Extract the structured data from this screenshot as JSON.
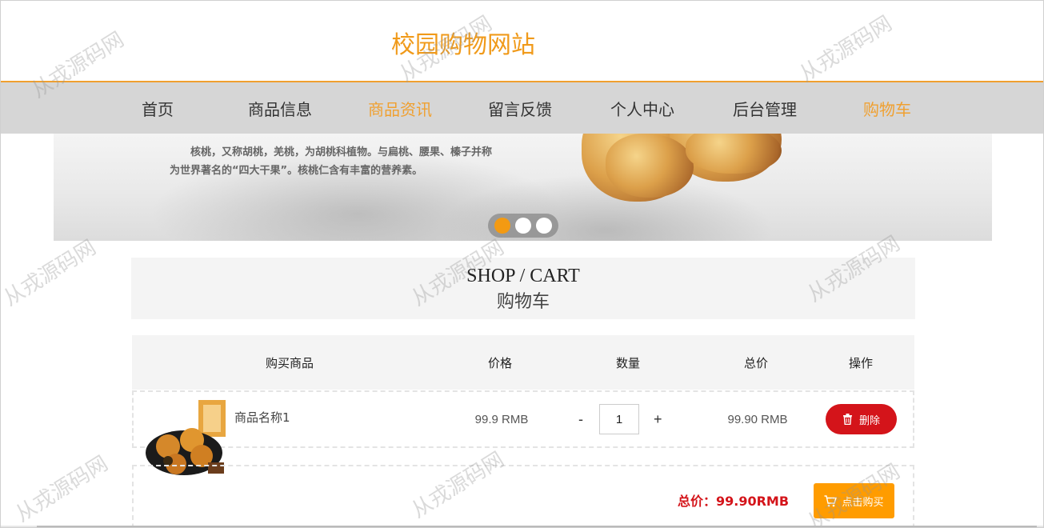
{
  "site": {
    "title": "校园购物网站"
  },
  "nav": {
    "items": [
      {
        "label": "首页",
        "active": false
      },
      {
        "label": "商品信息",
        "active": false
      },
      {
        "label": "商品资讯",
        "active": true
      },
      {
        "label": "留言反馈",
        "active": false
      },
      {
        "label": "个人中心",
        "active": false
      },
      {
        "label": "后台管理",
        "active": false
      },
      {
        "label": "购物车",
        "active": true
      }
    ]
  },
  "banner": {
    "text": "核桃，又称胡桃，羌桃，为胡桃科植物。与扁桃、腰果、榛子并称为世界著名的“四大干果”。核桃仁含有丰富的营养素。",
    "slide_count": 3,
    "active_slide": 1
  },
  "section": {
    "title_en": "SHOP / CART",
    "title_cn": "购物车"
  },
  "table": {
    "headers": {
      "product": "购买商品",
      "price": "价格",
      "quantity": "数量",
      "subtotal": "总价",
      "action": "操作"
    },
    "rows": [
      {
        "name": "商品名称1",
        "price": "99.9 RMB",
        "qty_minus": "-",
        "quantity": "1",
        "qty_plus": "+",
        "subtotal": "99.90 RMB",
        "delete_label": "删除"
      }
    ]
  },
  "summary": {
    "total": "总价：99.90RMB",
    "buy_label": "点击购买"
  },
  "watermark": "从戎源码网",
  "colors": {
    "accent": "#f09a1a",
    "danger": "#d4141a",
    "buy": "#ff9c00",
    "nav_bg": "#d6d6d6"
  },
  "icons": {
    "delete": "trash-icon",
    "buy": "cart-icon"
  }
}
